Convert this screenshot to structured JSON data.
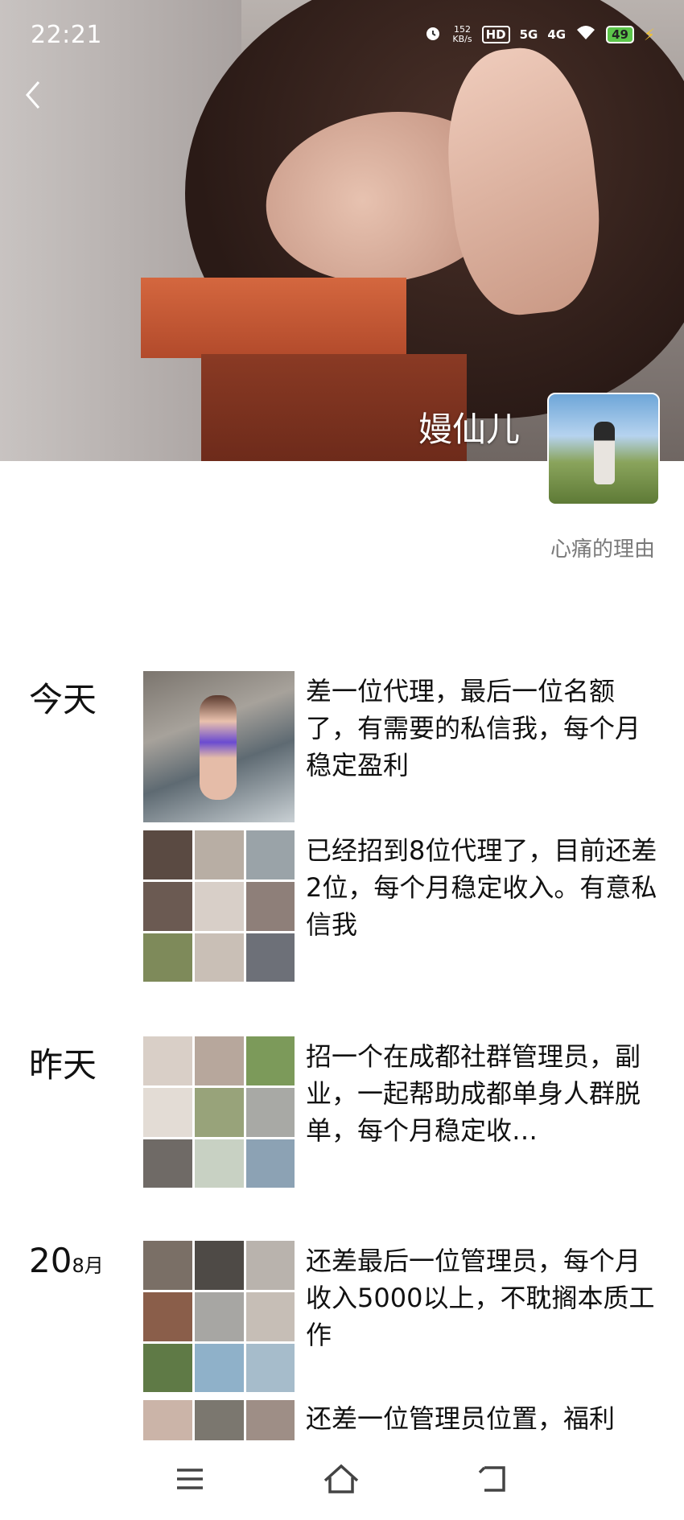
{
  "status_bar": {
    "time": "22:21",
    "speed_value": "152",
    "speed_unit": "KB/s",
    "hd": "HD",
    "sig5g": "5G",
    "sig4g": "4G",
    "battery": "49"
  },
  "profile": {
    "nickname": "嫚仙儿",
    "signature": "心痛的理由"
  },
  "days": [
    {
      "label": "今天"
    },
    {
      "label": "昨天"
    },
    {
      "label": "20",
      "month": "8月"
    }
  ],
  "posts": [
    {
      "text": "差一位代理，最后一位名额了，有需要的私信我，每个月稳定盈利"
    },
    {
      "text": "已经招到8位代理了，目前还差2位，每个月稳定收入。有意私信我"
    },
    {
      "text": "招一个在成都社群管理员，副业，一起帮助成都单身人群脱单，每个月稳定收…"
    },
    {
      "text": "还差最后一位管理员，每个月收入5000以上，不耽搁本质工作"
    },
    {
      "text": "还差一位管理员位置，福利"
    }
  ],
  "icons": {
    "back": "chevron-left-icon",
    "alarm": "alarm-icon",
    "wifi": "wifi-icon",
    "charging": "charging-icon",
    "nav_menu": "menu-icon",
    "nav_home": "home-icon",
    "nav_back": "back-arrow-icon"
  }
}
